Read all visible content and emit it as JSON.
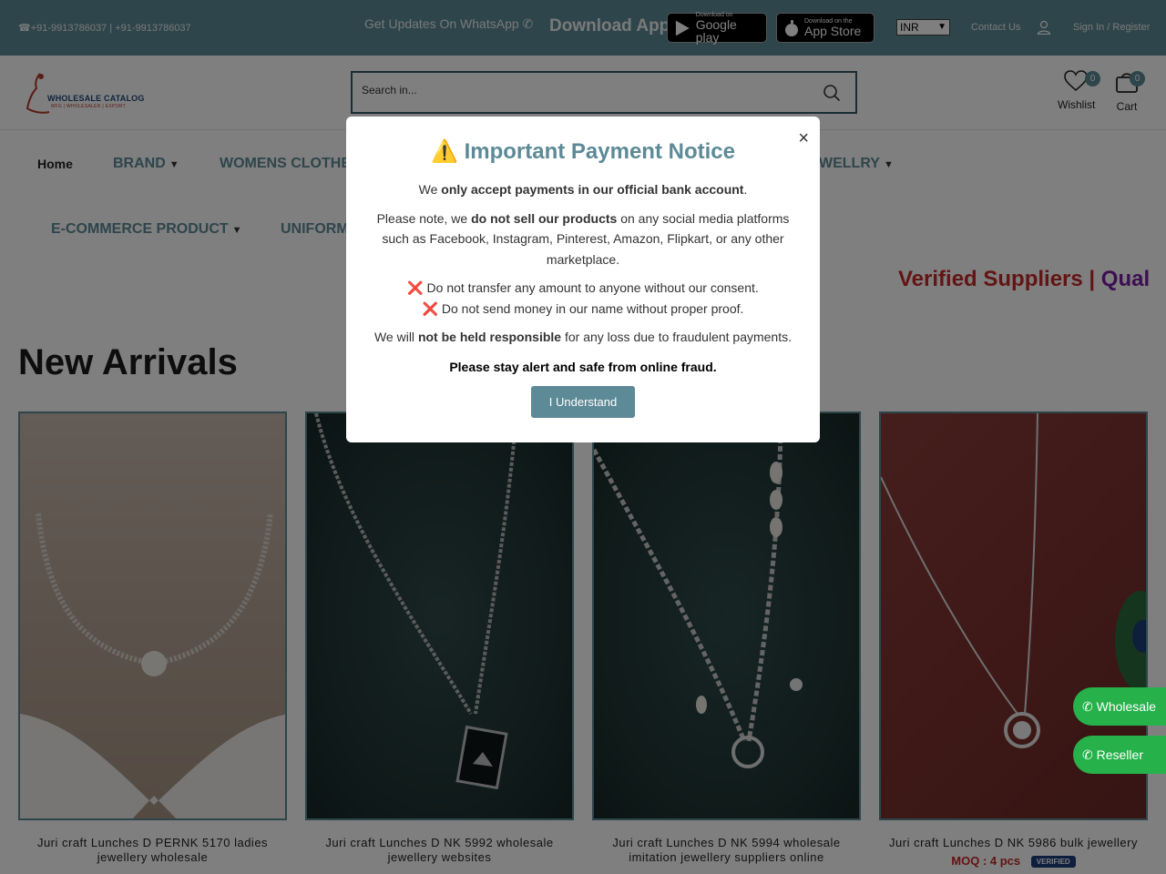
{
  "topbar": {
    "phones": "+91-9913786037 | +91-9913786037",
    "whatsapp_updates": "Get Updates On WhatsApp",
    "download_app": "Download App",
    "google_play_small": "Download on",
    "google_play_big": "Google play",
    "app_store_small": "Download on the",
    "app_store_big": "App Store",
    "currency": "INR",
    "contact_us": "Contact Us",
    "signin_register": "Sign In / Register"
  },
  "header": {
    "logo_brand": "WHOLESALE CATALOG",
    "logo_tag": "MFG | WHOLESALER | EXPORT",
    "search_placeholder": "Search in...",
    "wishlist_label": "Wishlist",
    "wishlist_count": "0",
    "cart_label": "Cart",
    "cart_count": "0"
  },
  "nav": {
    "home": "Home",
    "brand": "BRAND",
    "womens_clothing": "WOMENS CLOTHE",
    "jewellery": "WELLRY",
    "ecommerce": "E-COMMERCE PRODUCT",
    "uniform": "UNIFORM"
  },
  "marquee": {
    "part_a": "Verified Suppliers |",
    "part_b": "Qual"
  },
  "section_title": "New Arrivals",
  "products": [
    {
      "title": "Juri craft Lunches D PERNK 5170 ladies jewellery wholesale"
    },
    {
      "title": "Juri craft Lunches D NK 5992 wholesale jewellery websites"
    },
    {
      "title": "Juri craft Lunches D NK 5994 wholesale imitation jewellery suppliers online"
    },
    {
      "title": "Juri craft Lunches D NK 5986 bulk jewellery",
      "moq": "MOQ : 4 pcs",
      "verified": "VERIFIED"
    }
  ],
  "floating": {
    "wholesale": "Wholesale",
    "reseller": "Reseller"
  },
  "modal": {
    "title": "⚠️ Important Payment Notice",
    "p1_pre": "We ",
    "p1_bold": "only accept payments in our official bank account",
    "p1_post": ".",
    "p2_pre": "Please note, we ",
    "p2_bold": "do not sell our products",
    "p2_post": " on any social media platforms such as Facebook, Instagram, Pinterest, Amazon, Flipkart, or any other marketplace.",
    "warn1": "Do not transfer any amount to anyone without our consent.",
    "warn2": "Do not send money in our name without proper proof.",
    "p4_pre": "We will ",
    "p4_bold": "not be held responsible",
    "p4_post": " for any loss due to fraudulent payments.",
    "p5": "Please stay alert and safe from online fraud.",
    "button": "I Understand",
    "close": "×"
  },
  "colors": {
    "accent": "#5c8a96",
    "whatsapp_green": "#26b14a",
    "warning_red": "#c62828"
  }
}
